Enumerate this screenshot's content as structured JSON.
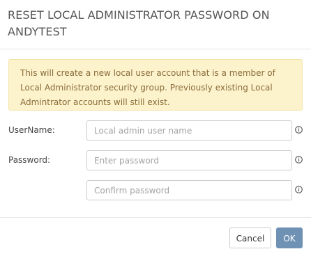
{
  "dialog": {
    "title": "RESET LOCAL ADMINISTRATOR PASSWORD ON ANDYTEST",
    "alert": "This will create a new local user account that is a member of Local Administrator security group. Previously existing Local Admintrator accounts will still exist.",
    "fields": {
      "username": {
        "label": "UserName:",
        "placeholder": "Local admin user name",
        "value": ""
      },
      "password": {
        "label": "Password:",
        "placeholder": "Enter password",
        "value": ""
      },
      "confirm": {
        "placeholder": "Confirm password",
        "value": ""
      }
    },
    "buttons": {
      "cancel": "Cancel",
      "ok": "OK"
    }
  },
  "colors": {
    "alert_bg": "#fcf2cc",
    "alert_text": "#8a6d3b",
    "ok_button": "#6f92b4"
  },
  "icons": {
    "field_help": "info-circle-icon"
  }
}
